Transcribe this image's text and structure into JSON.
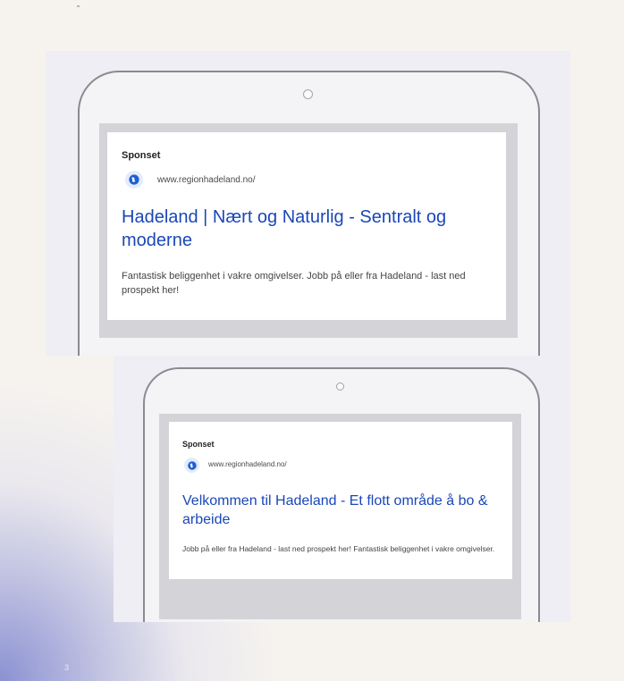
{
  "slide": {
    "page_number": "3"
  },
  "ads": [
    {
      "sponsored_label": "Sponset",
      "url": "www.regionhadeland.no/",
      "headline": "Hadeland | Nært og Naturlig - Sentralt og moderne",
      "description": "Fantastisk beliggenhet i vakre omgivelser. Jobb på eller fra Hadeland - last ned prospekt her!",
      "icon": "globe-icon",
      "link_color": "#1a47b8"
    },
    {
      "sponsored_label": "Sponset",
      "url": "www.regionhadeland.no/",
      "headline": "Velkommen til Hadeland - Et flott område å bo & arbeide",
      "description": "Jobb på eller fra Hadeland - last ned prospekt her! Fantastisk beliggenhet i vakre omgivelser.",
      "icon": "globe-icon",
      "link_color": "#1a47b8"
    }
  ]
}
